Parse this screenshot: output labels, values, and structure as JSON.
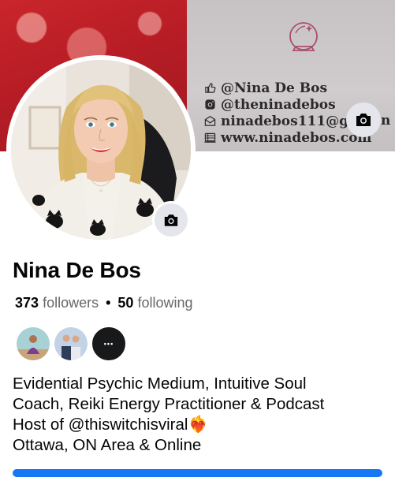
{
  "cover": {
    "lines": [
      {
        "icon": "thumbs-up-icon",
        "text": "@Nina De Bos"
      },
      {
        "icon": "instagram-icon",
        "text": "@theninadebos"
      },
      {
        "icon": "envelope-icon",
        "text": "ninadebos111@gma"
      },
      {
        "icon": "globe-icon",
        "text": "www.ninadebos.com"
      }
    ],
    "trailing_fragment": "n"
  },
  "profile": {
    "name": "Nina De Bos",
    "followers_count": "373",
    "followers_label": "followers",
    "separator": "•",
    "following_count": "50",
    "following_label": "following"
  },
  "friends": {
    "more_label": "•••"
  },
  "bio": {
    "lines": [
      "Evidential Psychic Medium, Intuitive Soul",
      "Coach, Reiki Energy Practitioner & Podcast",
      "Host of @thiswitchisviral❤️‍🔥",
      "Ottawa, ON Area & Online"
    ]
  },
  "colors": {
    "accent": "#1877f2",
    "cover_red": "#c9262c",
    "cover_gray": "#c9c5c6",
    "crystal_ball": "#a8506a"
  }
}
